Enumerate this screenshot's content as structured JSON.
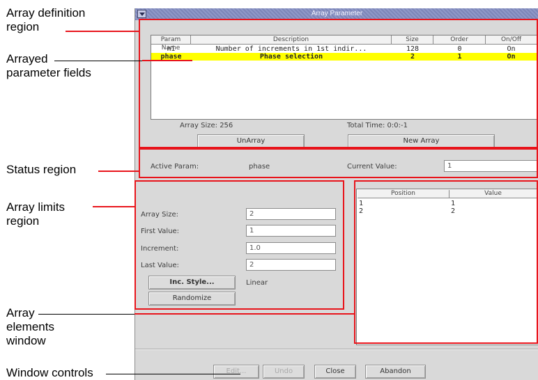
{
  "annotations": {
    "array_definition_region": "Array definition\nregion",
    "arrayed_parameter_fields": "Arrayed\nparameter fields",
    "status_region": "Status region",
    "array_limits_region": "Array limits\nregion",
    "array_elements_window": "Array\nelements\nwindow",
    "window_controls": "Window controls"
  },
  "window": {
    "title": "Array Parameter"
  },
  "param_table": {
    "headers": [
      "Param Name",
      "Description",
      "Size",
      "Order",
      "On/Off"
    ],
    "rows": [
      {
        "name": "ni",
        "description": "Number of increments in 1st indir...",
        "size": "128",
        "order": "0",
        "onoff": "On",
        "highlighted": false
      },
      {
        "name": "phase",
        "description": "Phase selection",
        "size": "2",
        "order": "1",
        "onoff": "On",
        "highlighted": true
      }
    ]
  },
  "summary": {
    "array_size": "Array Size: 256",
    "total_time": "Total Time: 0:0:-1"
  },
  "buttons": {
    "unarray": "UnArray",
    "new_array": "New Array",
    "inc_style": "Inc. Style...",
    "randomize": "Randomize",
    "edit": "Edit...",
    "undo": "Undo",
    "close": "Close",
    "abandon": "Abandon"
  },
  "status": {
    "active_param_label": "Active Param:",
    "active_param_value": "phase",
    "current_value_label": "Current Value:",
    "current_value": "1"
  },
  "limits": {
    "array_size_label": "Array Size:",
    "array_size_value": "2",
    "first_value_label": "First Value:",
    "first_value": "1",
    "increment_label": "Increment:",
    "increment_value": "1.0",
    "last_value_label": "Last Value:",
    "last_value": "2",
    "inc_style_value": "Linear"
  },
  "elements": {
    "headers": [
      "Position",
      "Value"
    ],
    "rows": [
      {
        "position": "1",
        "value": "1"
      },
      {
        "position": "2",
        "value": "2"
      }
    ]
  },
  "colors": {
    "annotation_red": "#e8141b",
    "highlight_row": "#ffff00",
    "window_bg": "#d9d9d9"
  }
}
